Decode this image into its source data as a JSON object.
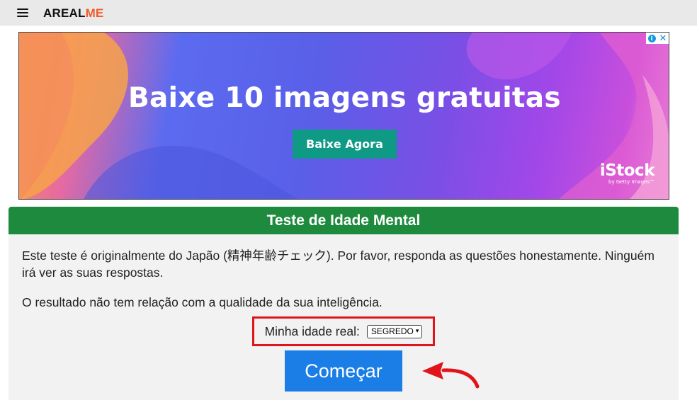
{
  "header": {
    "logo_main": "AREAL",
    "logo_accent": "ME",
    "menu_icon": "hamburger-menu-icon"
  },
  "ad": {
    "headline": "Baixe 10 imagens gratuitas",
    "button_label": "Baixe Agora",
    "brand": "iStock",
    "brand_sub": "by Getty Images™",
    "info_icon": "i",
    "close_icon": "✕",
    "button_color": "#0f9a86"
  },
  "quiz": {
    "title": "Teste de Idade Mental",
    "intro": "Este teste é originalmente do Japão (精神年齢チェック). Por favor, responda as questões honestamente. Ninguém irá ver as suas respostas.",
    "disclaimer": "O resultado não tem relação com a qualidade da sua inteligência.",
    "age_label": "Minha idade real:",
    "age_selected": "SEGREDO",
    "start_label": "Começar",
    "header_color": "#1e8a3e",
    "start_color": "#1a7ee6",
    "highlight_color": "#e0141a"
  }
}
